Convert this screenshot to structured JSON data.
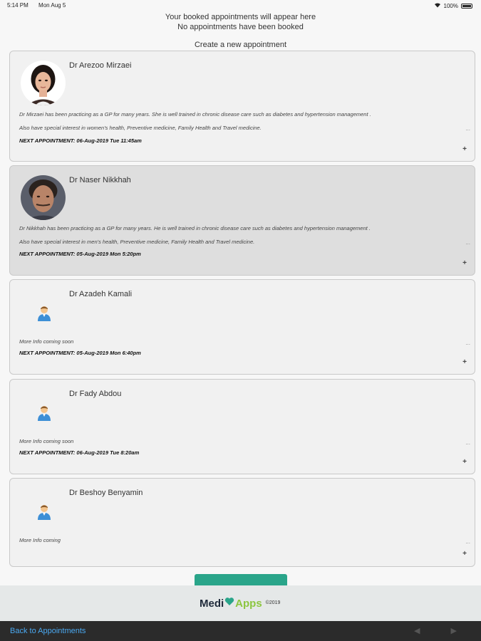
{
  "status_bar": {
    "time": "5:14 PM",
    "date": "Mon Aug 5",
    "battery": "100%"
  },
  "info": {
    "line1": "Your booked appointments will appear here",
    "line2": "No appointments have been booked",
    "create_label": "Create a new appointment"
  },
  "doctors": [
    {
      "name": "Dr Arezoo Mirzaei",
      "desc1": "Dr Mirzaei has been practicing as a GP for many years. She is well trained in chronic disease care such as diabetes and hypertension management .",
      "desc2": "Also have special interest in women's health, Preventive medicine, Family Health and Travel medicine.",
      "next": "NEXT APPOINTMENT: 06-Aug-2019 Tue 11:45am",
      "more": "...",
      "plus": "+"
    },
    {
      "name": "Dr Naser Nikkhah",
      "desc1": "Dr Nikkhah has been practicing as a GP for many years. He is well trained in chronic disease care such as diabetes and hypertension management .",
      "desc2": "Also have special interest in men's health, Preventive medicine, Family Health and Travel medicine.",
      "next": "NEXT APPOINTMENT: 05-Aug-2019 Mon 5:20pm",
      "more": "...",
      "plus": "+"
    },
    {
      "name": "Dr Azadeh Kamali",
      "desc1": "More Info coming soon",
      "next": "NEXT APPOINTMENT: 05-Aug-2019 Mon 6:40pm",
      "more": "...",
      "plus": "+"
    },
    {
      "name": "Dr Fady Abdou",
      "desc1": "More Info coming soon",
      "next": "NEXT APPOINTMENT: 06-Aug-2019 Tue 8:20am",
      "more": "...",
      "plus": "+"
    },
    {
      "name": "Dr Beshoy Benyamin",
      "desc1": "More Info coming",
      "more": "...",
      "plus": "+"
    }
  ],
  "footer": {
    "logo_part1": "Medi",
    "logo_part2": "Apps",
    "copyright": "©2019"
  },
  "bottom_bar": {
    "back_label": "Back to Appointments",
    "prev": "◀",
    "next": "▶"
  },
  "colors": {
    "accent": "#2aa58a",
    "link": "#4aa8f0",
    "logo_green": "#8cc63f"
  }
}
